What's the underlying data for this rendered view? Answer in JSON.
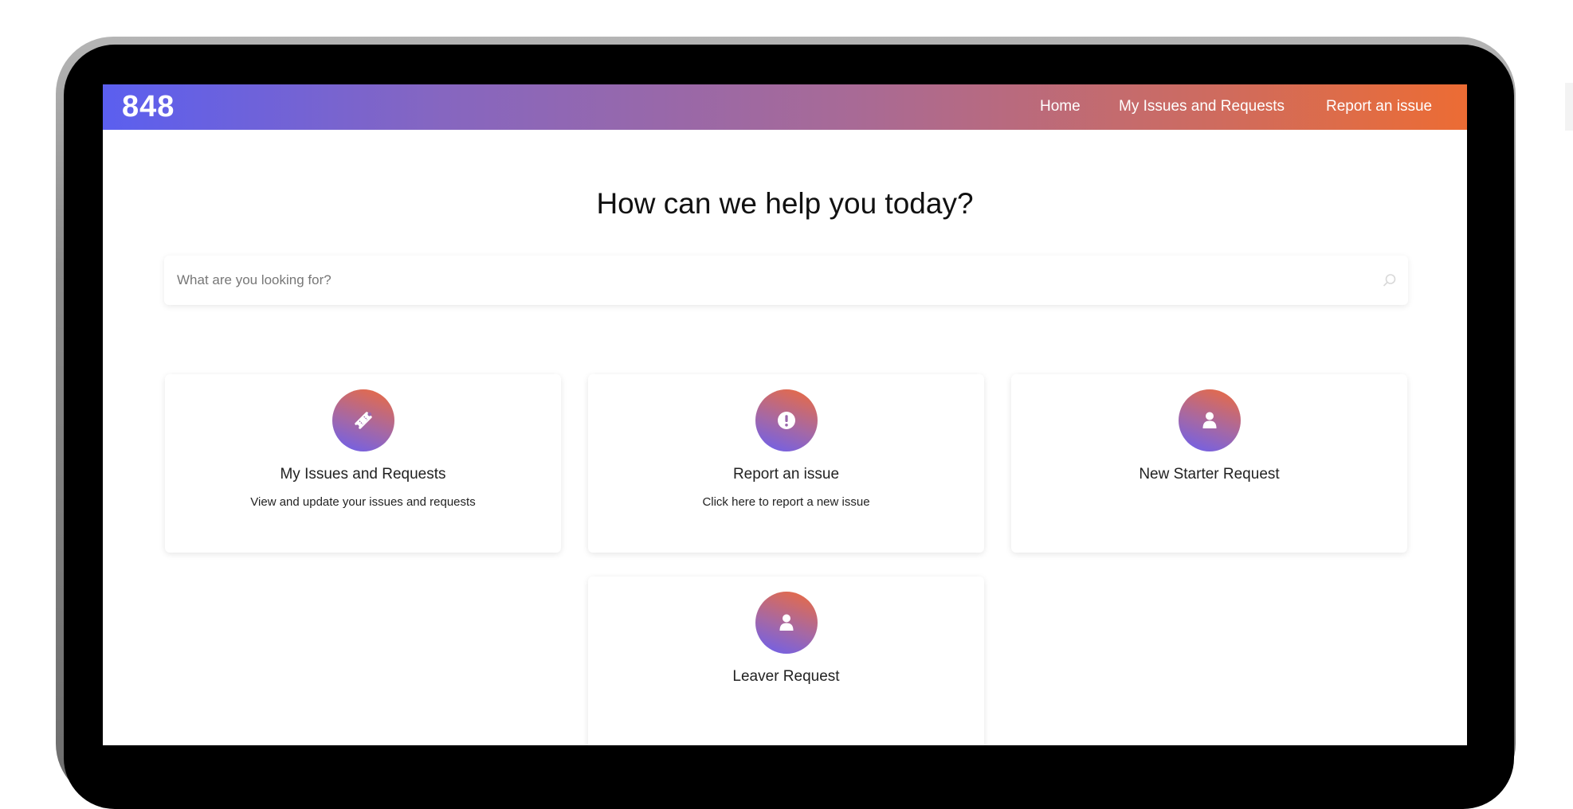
{
  "brand": "848",
  "nav": {
    "items": [
      {
        "label": "Home"
      },
      {
        "label": "My Issues and Requests"
      },
      {
        "label": "Report an issue"
      }
    ]
  },
  "hero": {
    "title": "How can we help you today?"
  },
  "search": {
    "placeholder": "What are you looking for?",
    "value": ""
  },
  "cards": [
    {
      "title": "My Issues and Requests",
      "description": "View and update your issues and requests",
      "icon": "ticket-icon"
    },
    {
      "title": "Report an issue",
      "description": "Click here to report a new issue",
      "icon": "exclamation-circle-icon"
    },
    {
      "title": "New Starter Request",
      "description": "",
      "icon": "user-icon"
    },
    {
      "title": "Leaver Request",
      "description": "",
      "icon": "user-icon"
    }
  ],
  "colors": {
    "gradient_start": "#5b5fef",
    "gradient_end": "#ec6c34"
  }
}
